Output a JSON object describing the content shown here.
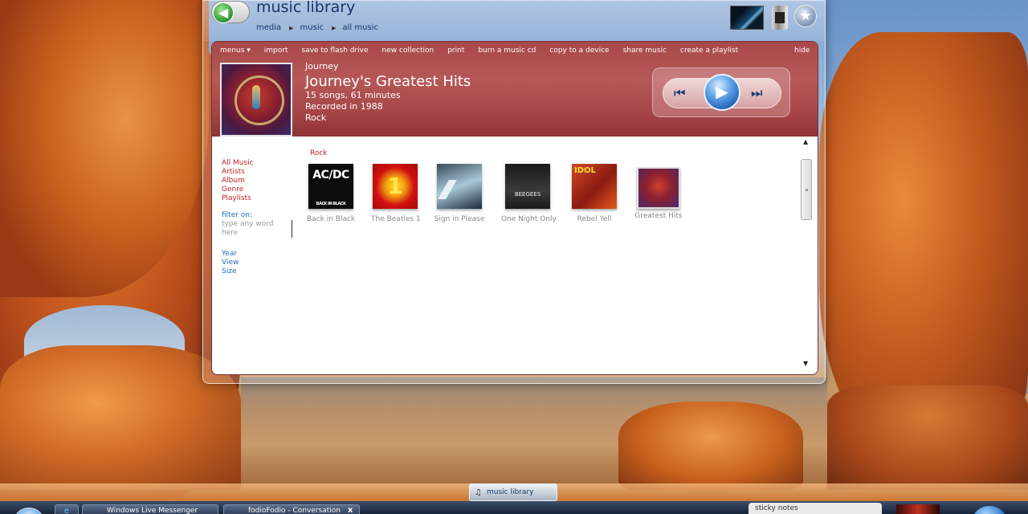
{
  "window": {
    "title": "music library",
    "breadcrumb": [
      "media",
      "music",
      "all music"
    ]
  },
  "menubar": {
    "items": [
      "menus ▾",
      "import",
      "save to flash drive",
      "new collection",
      "print",
      "burn a music cd",
      "copy to a device",
      "share music",
      "create a playlist"
    ],
    "hide_label": "hide"
  },
  "now_playing": {
    "artist": "Journey",
    "album": "Journey's Greatest Hits",
    "songs": "15 songs, 61 minutes",
    "recorded": "Recorded in 1988",
    "genre": "Rock"
  },
  "sidebar": {
    "nav": [
      "All Music",
      "Artists",
      "Album",
      "Genre",
      "Playlists"
    ],
    "filter_label": "filter on:",
    "filter_placeholder": "type any word here",
    "options": [
      "Year",
      "View",
      "Size"
    ]
  },
  "library": {
    "genre_heading": "Rock",
    "albums": [
      {
        "title": "Back in Black",
        "cover_text": "AC/DC",
        "cover_sub": "BACK IN BLACK"
      },
      {
        "title": "The Beatles 1",
        "cover_text": "1"
      },
      {
        "title": "Sign in Please",
        "cover_text": ""
      },
      {
        "title": "One Night Only",
        "cover_text": "BEEGEES"
      },
      {
        "title": "Rebel Yell",
        "cover_text": "IDOL"
      },
      {
        "title": "Greatest Hits",
        "cover_text": ""
      }
    ]
  },
  "taskbar": {
    "active_pill": "music library",
    "buttons": [
      "Windows Live Messenger",
      "fodioFodio - Conversation"
    ],
    "close_glyph": "x",
    "sticky_notes": "sticky notes"
  },
  "icons": {
    "back": "back-arrow-icon",
    "star": "star-icon",
    "prev": "previous-track-icon",
    "play": "play-icon",
    "next": "next-track-icon",
    "scroll_up": "scroll-up-arrow-icon",
    "scroll_down": "scroll-down-arrow-icon"
  },
  "colors": {
    "header_red": "#a84849",
    "link_red": "#c02222",
    "link_blue": "#1e6bbf",
    "title_blue": "#17356a"
  }
}
